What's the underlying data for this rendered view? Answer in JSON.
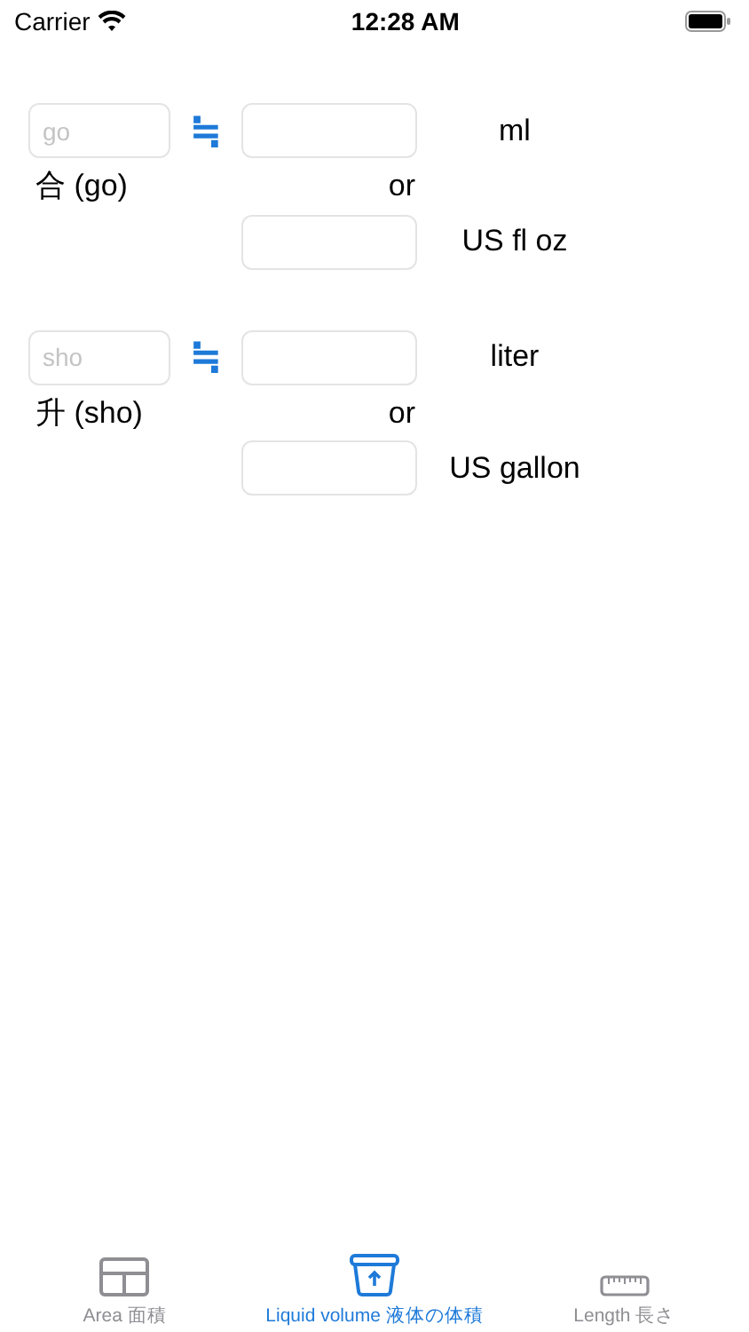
{
  "status_bar": {
    "carrier": "Carrier",
    "time": "12:28 AM"
  },
  "converters": [
    {
      "placeholder": "go",
      "approx": "≒",
      "label": "合 (go)",
      "or": "or",
      "units": [
        "ml",
        "US fl oz"
      ]
    },
    {
      "placeholder": "sho",
      "approx": "≒",
      "label": "升 (sho)",
      "or": "or",
      "units": [
        "liter",
        "US gallon"
      ]
    }
  ],
  "tabs": [
    {
      "kind": "area",
      "label": "Area 面積",
      "selected": false
    },
    {
      "kind": "volume",
      "label": "Liquid volume 液体の体積",
      "selected": true
    },
    {
      "kind": "length",
      "label": "Length 長さ",
      "selected": false
    }
  ]
}
